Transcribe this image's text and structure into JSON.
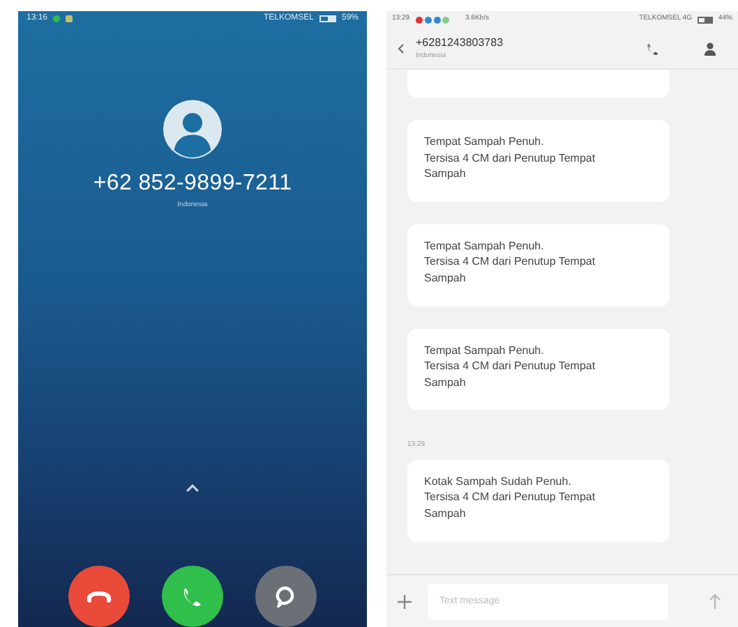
{
  "call_screen": {
    "status_bar": {
      "time": "13:16",
      "carrier": "TELKOMSEL",
      "battery": "59%"
    },
    "caller_number": "+62 852-9899-7211",
    "caller_location": "Indonesia",
    "actions": [
      {
        "kind": "decline"
      },
      {
        "kind": "answer"
      },
      {
        "kind": "message"
      }
    ]
  },
  "messages_screen": {
    "status_bar": {
      "time": "13:29",
      "speed": "3.6Kb/s",
      "carrier": "TELKOMSEL 4G",
      "battery": "44%"
    },
    "contact_number": "+6281243803783",
    "contact_location": "Indonesia",
    "messages": [
      {
        "kind": "message",
        "text": "Tempat Sampah Penuh.\nTersisa 4 CM dari Penutup Tempat Sampah"
      },
      {
        "kind": "message",
        "text": "Tempat Sampah Penuh.\nTersisa 4 CM dari Penutup Tempat Sampah"
      },
      {
        "kind": "message",
        "text": "Tempat Sampah Penuh.\nTersisa 4 CM dari Penutup Tempat Sampah"
      },
      {
        "kind": "time",
        "text": "13:29"
      },
      {
        "kind": "message",
        "text": "Kotak Sampah Sudah Penuh.\nTersisa 4 CM dari Penutup Tempat Sampah"
      }
    ],
    "composer": {
      "placeholder": "Text message"
    }
  }
}
